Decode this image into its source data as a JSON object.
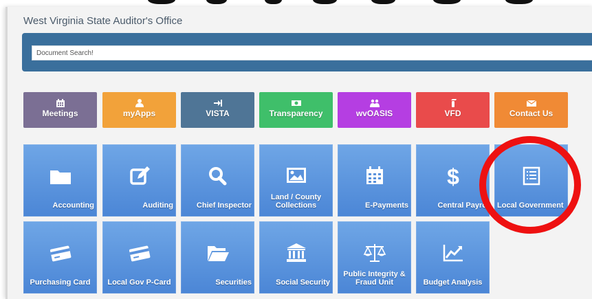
{
  "header": {
    "site_title": "West Virginia State Auditor's Office"
  },
  "search": {
    "placeholder": "Document Search!"
  },
  "quick_links": [
    {
      "label": "Meetings",
      "icon": "calendar-icon",
      "color": "#7b6f94"
    },
    {
      "label": "myApps",
      "icon": "user-icon",
      "color": "#f2a23a"
    },
    {
      "label": "VISTA",
      "icon": "sign-in-icon",
      "color": "#4f7596"
    },
    {
      "label": "Transparency",
      "icon": "money-icon",
      "color": "#3fbf6a"
    },
    {
      "label": "wvOASIS",
      "icon": "users-icon",
      "color": "#b53ee2"
    },
    {
      "label": "VFD",
      "icon": "fire-extinguisher-icon",
      "color": "#e94b4b"
    },
    {
      "label": "Contact Us",
      "icon": "envelope-icon",
      "color": "#f08a35"
    }
  ],
  "tiles_row1": [
    {
      "label": "Accounting",
      "icon": "folder-icon"
    },
    {
      "label": "Auditing",
      "icon": "edit-icon"
    },
    {
      "label": "Chief Inspector",
      "icon": "search-icon"
    },
    {
      "label": "Land / County Collections",
      "icon": "image-icon"
    },
    {
      "label": "E-Payments",
      "icon": "calendar-grid-icon"
    },
    {
      "label": "Central Payro",
      "icon": "dollar-icon"
    },
    {
      "label": "Local Government",
      "icon": "list-document-icon"
    }
  ],
  "tiles_row2": [
    {
      "label": "Purchasing Card",
      "icon": "credit-card-icon"
    },
    {
      "label": "Local Gov P-Card",
      "icon": "credit-card-icon"
    },
    {
      "label": "Securities",
      "icon": "folder-open-icon"
    },
    {
      "label": "Social Security",
      "icon": "bank-icon"
    },
    {
      "label": "Public Integrity & Fraud Unit",
      "icon": "balance-scale-icon"
    },
    {
      "label": "Budget Analysis",
      "icon": "line-chart-icon"
    }
  ],
  "colors": {
    "tile_blue": "#5a92dc",
    "search_band": "#3a6f9c",
    "annotation_red": "#ee1111"
  }
}
